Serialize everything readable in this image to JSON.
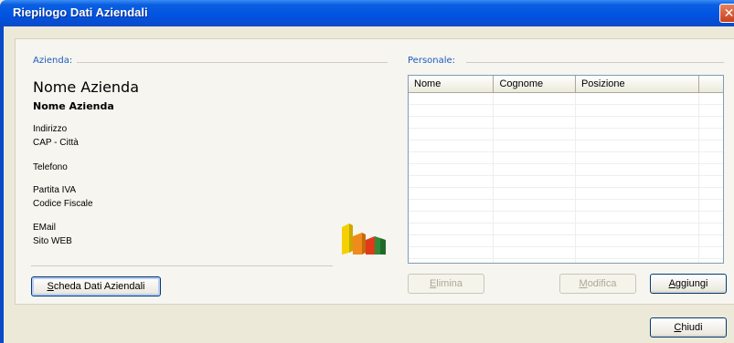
{
  "window": {
    "title": "Riepilogo Dati Aziendali",
    "close_glyph": "✕"
  },
  "azienda": {
    "group_label": "Azienda:",
    "name_large": "Nome Azienda",
    "name_bold": "Nome Azienda",
    "address": "Indirizzo",
    "cap_city": "CAP - Città",
    "phone": "Telefono",
    "vat": "Partita IVA",
    "tax_code": "Codice Fiscale",
    "email": "EMail",
    "website": "Sito WEB",
    "button_label": "Scheda Dati Aziendali",
    "button_underline": "S",
    "button_rest": "cheda Dati Aziendali"
  },
  "personale": {
    "group_label": "Personale:",
    "columns": [
      "Nome",
      "Cognome",
      "Posizione"
    ],
    "rows": [],
    "buttons": {
      "elimina_underline": "E",
      "elimina_rest": "limina",
      "modifica_underline": "M",
      "modifica_rest": "odifica",
      "aggiungi_underline": "A",
      "aggiungi_rest": "ggiungi"
    }
  },
  "footer": {
    "chiudi_underline": "C",
    "chiudi_rest": "hiudi"
  },
  "colors": {
    "titlebar": "#0054e3",
    "group_label": "#1d5bbf",
    "face": "#ece9d8"
  },
  "icons": [
    "close-icon",
    "bar-chart-icon"
  ]
}
